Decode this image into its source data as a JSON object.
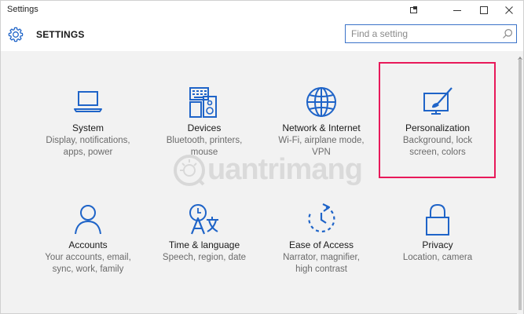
{
  "window": {
    "title": "Settings"
  },
  "header": {
    "app_title": "SETTINGS",
    "search_placeholder": "Find a setting"
  },
  "tiles": [
    {
      "name": "System",
      "desc1": "Display, notifications,",
      "desc2": "apps, power",
      "icon": "laptop-icon"
    },
    {
      "name": "Devices",
      "desc1": "Bluetooth, printers,",
      "desc2": "mouse",
      "icon": "devices-icon"
    },
    {
      "name": "Network & Internet",
      "desc1": "Wi-Fi, airplane mode,",
      "desc2": "VPN",
      "icon": "globe-icon"
    },
    {
      "name": "Personalization",
      "desc1": "Background, lock",
      "desc2": "screen, colors",
      "icon": "paintbrush-monitor-icon"
    },
    {
      "name": "Accounts",
      "desc1": "Your accounts, email,",
      "desc2": "sync, work, family",
      "icon": "person-icon"
    },
    {
      "name": "Time & language",
      "desc1": "Speech, region, date",
      "desc2": "",
      "icon": "time-language-icon"
    },
    {
      "name": "Ease of Access",
      "desc1": "Narrator, magnifier,",
      "desc2": "high contrast",
      "icon": "ease-of-access-icon"
    },
    {
      "name": "Privacy",
      "desc1": "Location, camera",
      "desc2": "",
      "icon": "lock-icon"
    }
  ],
  "watermark": {
    "text": "uantrimang"
  },
  "colors": {
    "accent": "#1f64c8",
    "highlight": "#e8195a"
  }
}
